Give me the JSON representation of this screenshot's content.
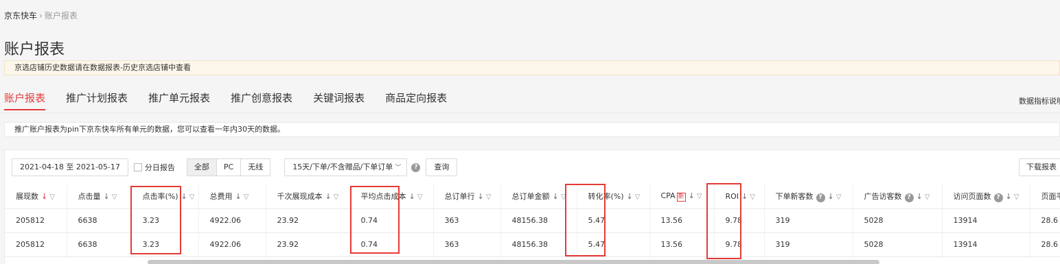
{
  "breadcrumb": {
    "root": "京东快车",
    "separator": "›",
    "current": "账户报表"
  },
  "page_title": "账户报表",
  "notice": "京选店铺历史数据请在数据报表-历史京选店铺中查看",
  "tabs": [
    {
      "label": "账户报表",
      "active": true
    },
    {
      "label": "推广计划报表",
      "active": false
    },
    {
      "label": "推广单元报表",
      "active": false
    },
    {
      "label": "推广创意报表",
      "active": false
    },
    {
      "label": "关键词报表",
      "active": false
    },
    {
      "label": "商品定向报表",
      "active": false
    }
  ],
  "metrics_link": "数据指标说明",
  "info": "推广账户报表为pin下京东快车所有单元的数据，您可以查看一年内30天的数据。",
  "toolbar": {
    "date_range": "2021-04-18 至 2021-05-17",
    "daily_report_label": "分日报告",
    "daily_report_checked": false,
    "segments": [
      {
        "label": "全部",
        "active": true
      },
      {
        "label": "PC",
        "active": false
      },
      {
        "label": "无线",
        "active": false
      }
    ],
    "attribution_select": "15天/下单/不含赠品/下单订单",
    "help_icon": "?",
    "query_label": "查询",
    "download_label": "下载报表"
  },
  "table": {
    "columns": [
      {
        "label": "展现数",
        "sort": "↓",
        "sort_active": true,
        "filter": "▽",
        "width": 90
      },
      {
        "label": "点击量",
        "sort": "↓",
        "sort_active": false,
        "filter": "▽",
        "width": 94
      },
      {
        "label": "点击率(%)",
        "sort": "↓",
        "sort_active": false,
        "filter": "▽",
        "width": 98
      },
      {
        "label": "总费用",
        "sort": "↓",
        "sort_active": false,
        "filter": "▽",
        "width": 98
      },
      {
        "label": "千次展现成本",
        "sort": "↓",
        "sort_active": false,
        "filter": "▽",
        "width": 122
      },
      {
        "label": "平均点击成本",
        "sort": "↓",
        "sort_active": false,
        "filter": "▽",
        "width": 122
      },
      {
        "label": "总订单行",
        "sort": "↓",
        "sort_active": false,
        "filter": "▽",
        "width": 98
      },
      {
        "label": "总订单金额",
        "sort": "↓",
        "sort_active": false,
        "filter": "▽",
        "width": 111
      },
      {
        "label": "转化率(%)",
        "sort": "↓",
        "sort_active": false,
        "filter": "▽",
        "width": 106
      },
      {
        "label": "CPA",
        "badge": "新",
        "sort": "↓",
        "sort_active": false,
        "filter": "▽",
        "width": 94
      },
      {
        "label": "ROI",
        "sort": "↓",
        "sort_active": false,
        "filter": "▽",
        "width": 73
      },
      {
        "label": "下单新客数",
        "help": "?",
        "sort": "↓",
        "sort_active": false,
        "filter": "▽",
        "width": 129
      },
      {
        "label": "广告访客数",
        "help": "?",
        "sort": "↓",
        "sort_active": false,
        "filter": "▽",
        "width": 130
      },
      {
        "label": "访问页面数",
        "help": "?",
        "sort": "↓",
        "sort_active": false,
        "filter": "▽",
        "width": 128
      },
      {
        "label": "页面平均",
        "width": 60
      }
    ],
    "rows": [
      [
        "205812",
        "6638",
        "3.23",
        "4922.06",
        "23.92",
        "0.74",
        "363",
        "48156.38",
        "5.47",
        "13.56",
        "9.78",
        "319",
        "5028",
        "13914",
        "28.6"
      ],
      [
        "205812",
        "6638",
        "3.23",
        "4922.06",
        "23.92",
        "0.74",
        "363",
        "48156.38",
        "5.47",
        "13.56",
        "9.78",
        "319",
        "5028",
        "13914",
        "28.6"
      ]
    ]
  },
  "colors": {
    "accent": "#e4393c",
    "highlight": "#e53935",
    "notice_bg": "#fdf6ea"
  }
}
